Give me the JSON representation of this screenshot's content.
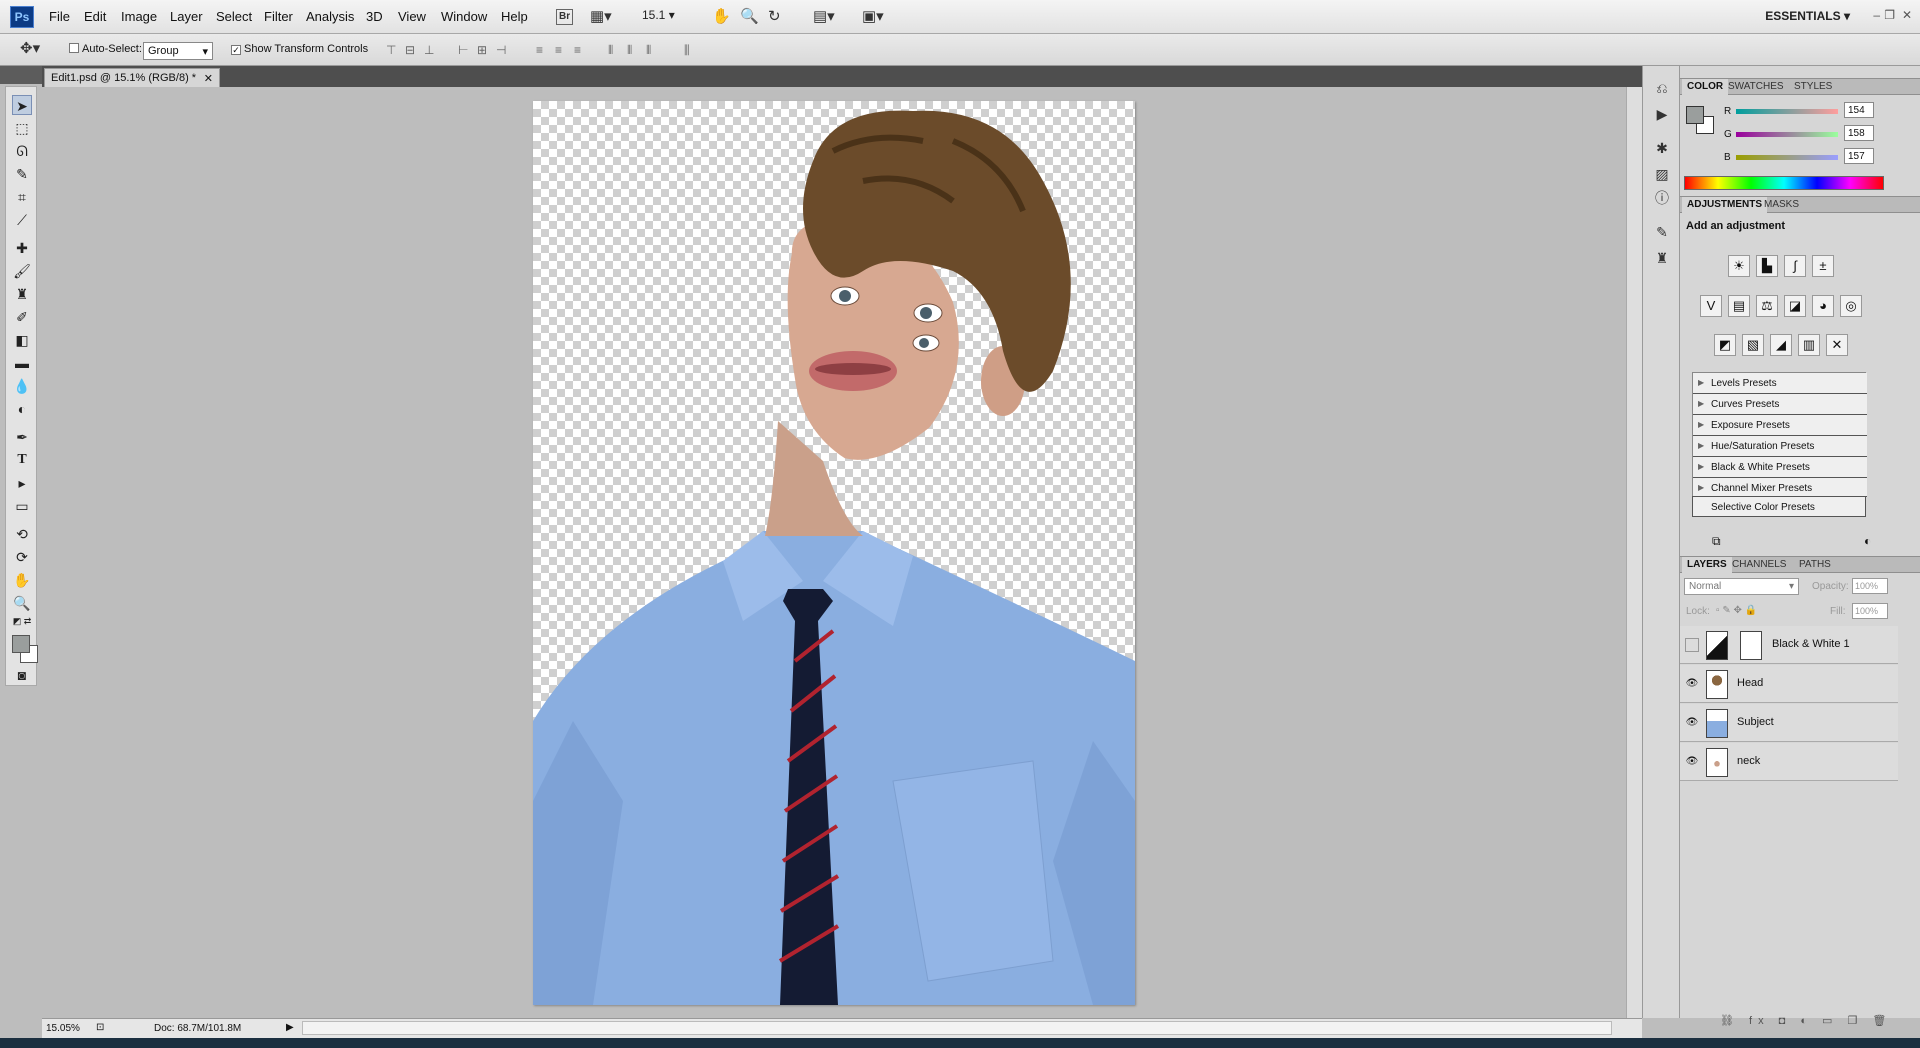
{
  "app": {
    "logo": "Ps"
  },
  "menu": [
    "File",
    "Edit",
    "Image",
    "Layer",
    "Select",
    "Filter",
    "Analysis",
    "3D",
    "View",
    "Window",
    "Help"
  ],
  "appbar": {
    "bridge": "Br",
    "zoom": "15.1",
    "workspace": "ESSENTIALS"
  },
  "options": {
    "auto_select": "Auto-Select:",
    "auto_select_value": "Group",
    "show_transform": "Show Transform Controls"
  },
  "document": {
    "tab_title": "Edit1.psd @ 15.1% (RGB/8) *"
  },
  "status": {
    "zoom": "15.05%",
    "doc_size": "Doc: 68.7M/101.8M"
  },
  "color_panel": {
    "tabs": [
      "COLOR",
      "SWATCHES",
      "STYLES"
    ],
    "channels": [
      {
        "label": "R",
        "value": "154"
      },
      {
        "label": "G",
        "value": "158"
      },
      {
        "label": "B",
        "value": "157"
      }
    ],
    "foreground": "#9a9e9d"
  },
  "adjustments": {
    "tabs": [
      "ADJUSTMENTS",
      "MASKS"
    ],
    "title": "Add an adjustment",
    "presets": [
      "Levels Presets",
      "Curves Presets",
      "Exposure Presets",
      "Hue/Saturation Presets",
      "Black & White Presets",
      "Channel Mixer Presets",
      "Selective Color Presets"
    ]
  },
  "layers_panel": {
    "tabs": [
      "LAYERS",
      "CHANNELS",
      "PATHS"
    ],
    "blend_mode": "Normal",
    "opacity_label": "Opacity:",
    "opacity": "100%",
    "lock_label": "Lock:",
    "fill_label": "Fill:",
    "fill": "100%",
    "layers": [
      {
        "name": "Black & White 1",
        "visible": false
      },
      {
        "name": "Head",
        "visible": true
      },
      {
        "name": "Subject",
        "visible": true
      },
      {
        "name": "neck",
        "visible": true
      }
    ]
  }
}
